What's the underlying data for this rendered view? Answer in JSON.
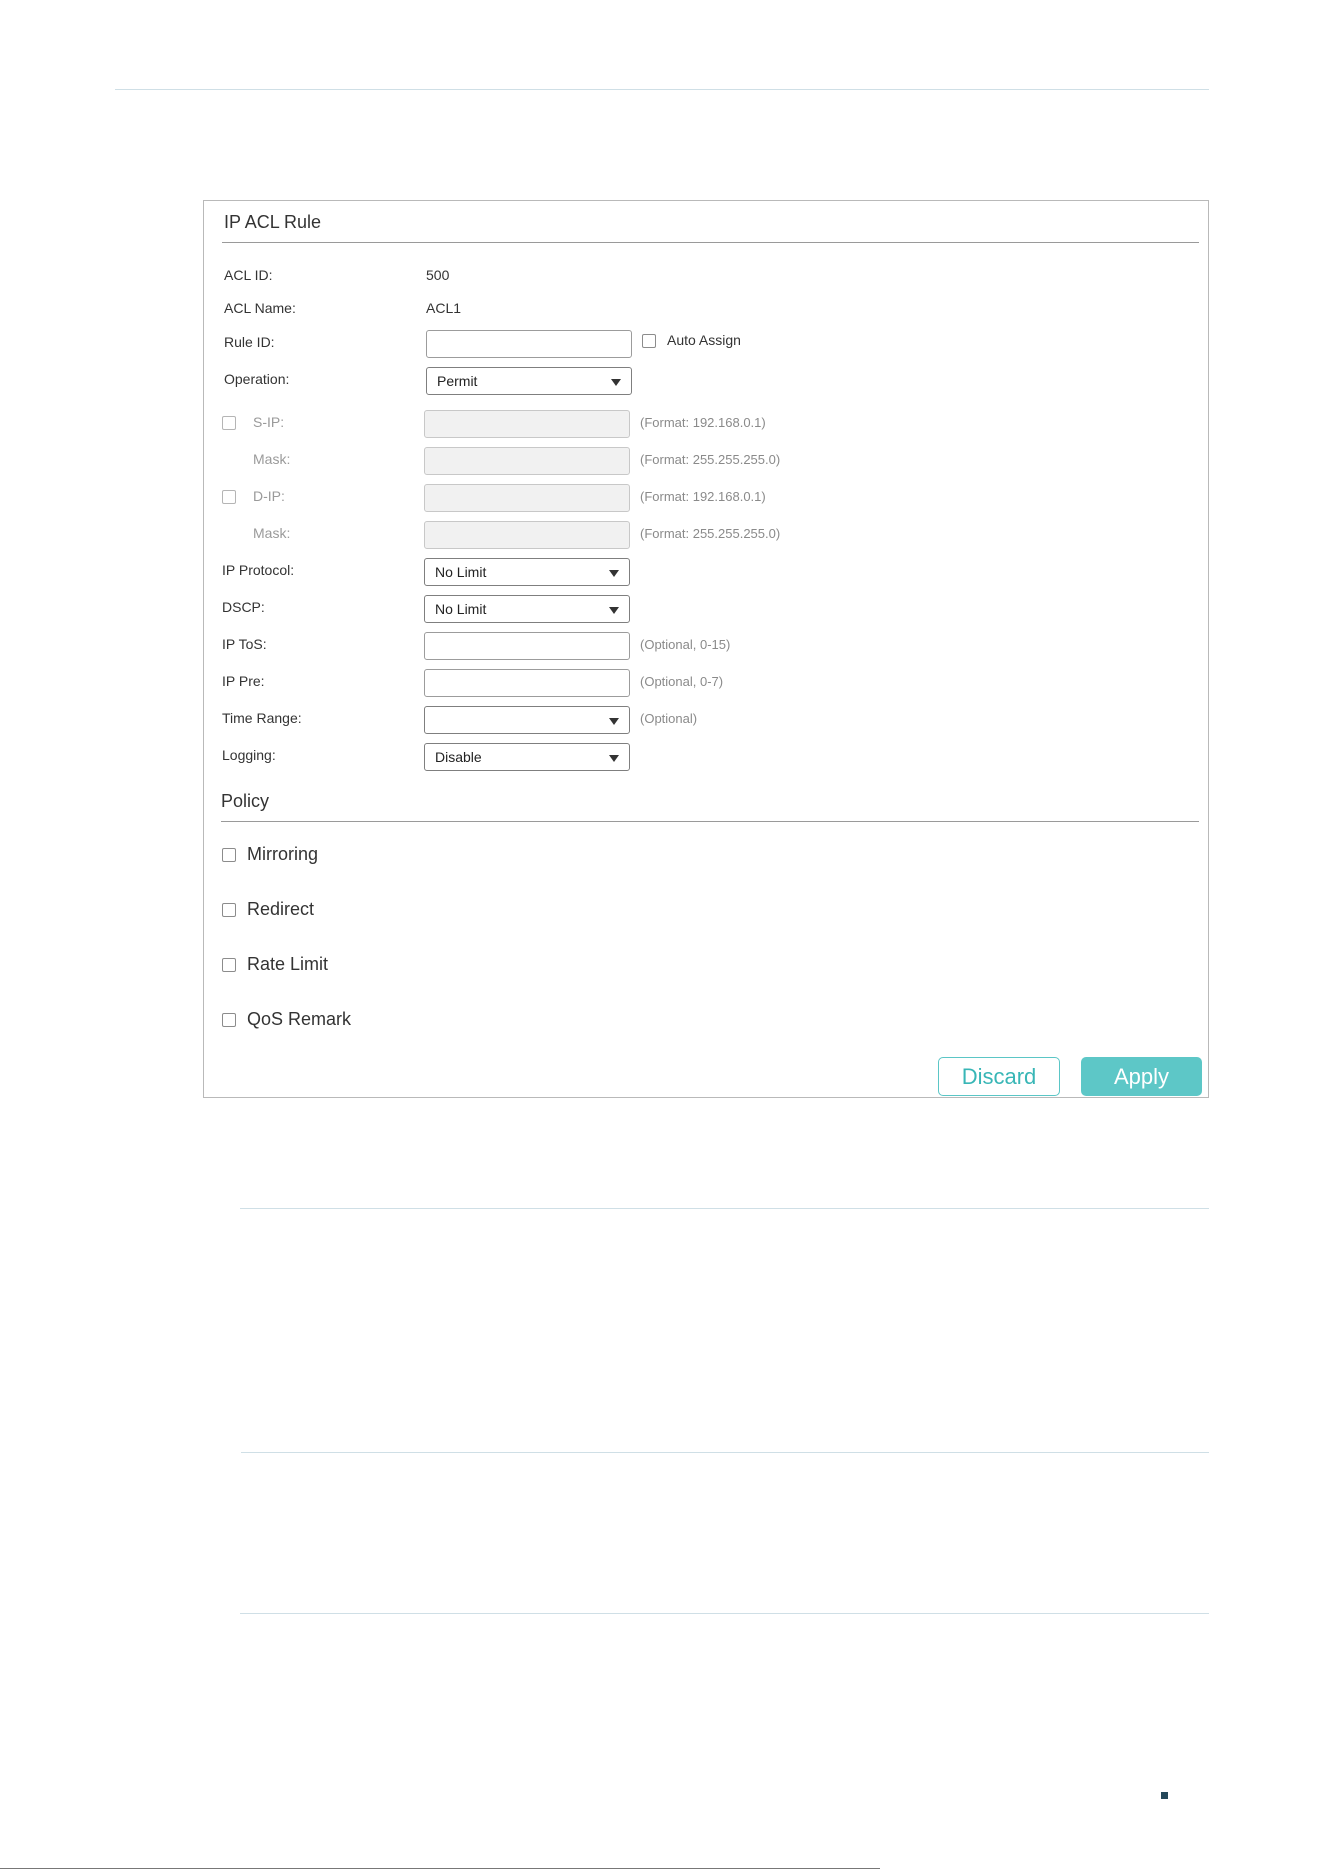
{
  "ip_acl_rule": {
    "title": "IP ACL Rule",
    "acl_id": {
      "label": "ACL ID:",
      "value": "500"
    },
    "acl_name": {
      "label": "ACL Name:",
      "value": "ACL1"
    },
    "rule_id": {
      "label": "Rule ID:",
      "value": "",
      "auto_assign_label": "Auto Assign",
      "auto_assign_checked": false
    },
    "operation": {
      "label": "Operation:",
      "selected": "Permit"
    },
    "s_ip": {
      "label": "S-IP:",
      "hint": "(Format: 192.168.0.1)",
      "checked": false
    },
    "s_mask": {
      "label": "Mask:",
      "hint": "(Format: 255.255.255.0)"
    },
    "d_ip": {
      "label": "D-IP:",
      "hint": "(Format: 192.168.0.1)",
      "checked": false
    },
    "d_mask": {
      "label": "Mask:",
      "hint": "(Format: 255.255.255.0)"
    },
    "ip_protocol": {
      "label": "IP Protocol:",
      "selected": "No Limit"
    },
    "dscp": {
      "label": "DSCP:",
      "selected": "No Limit"
    },
    "ip_tos": {
      "label": "IP ToS:",
      "hint": "(Optional, 0-15)"
    },
    "ip_pre": {
      "label": "IP Pre:",
      "hint": "(Optional, 0-7)"
    },
    "time_range": {
      "label": "Time Range:",
      "selected": "",
      "hint": "(Optional)"
    },
    "logging": {
      "label": "Logging:",
      "selected": "Disable"
    }
  },
  "policy": {
    "title": "Policy",
    "items": [
      {
        "label": "Mirroring",
        "checked": false
      },
      {
        "label": "Redirect",
        "checked": false
      },
      {
        "label": "Rate Limit",
        "checked": false
      },
      {
        "label": "QoS Remark",
        "checked": false
      }
    ]
  },
  "buttons": {
    "discard": "Discard",
    "apply": "Apply"
  },
  "colors": {
    "accent": "#5dc7c7",
    "rule_line": "#cfdfe6",
    "page_mark": "#24485a"
  }
}
